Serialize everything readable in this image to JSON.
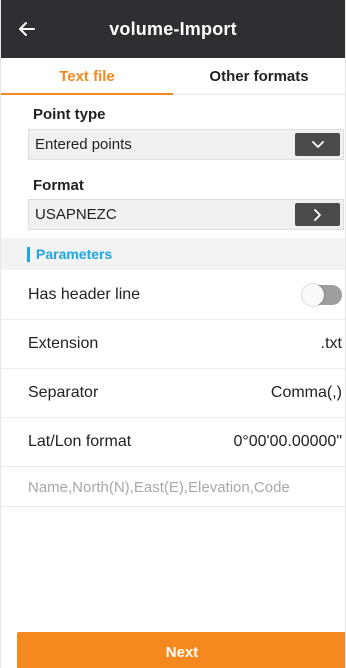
{
  "header": {
    "title": "volume-Import",
    "back_icon": "arrow-left-icon"
  },
  "tabs": [
    {
      "label": "Text file",
      "active": true
    },
    {
      "label": "Other formats",
      "active": false
    }
  ],
  "point_type": {
    "label": "Point type",
    "value": "Entered points",
    "icon": "chevron-down-icon"
  },
  "format": {
    "label": "Format",
    "value": "USAPNEZC",
    "icon": "chevron-right-icon"
  },
  "parameters": {
    "title": "Parameters",
    "has_header_line": {
      "label": "Has header line",
      "enabled": false
    },
    "extension": {
      "label": "Extension",
      "value": ".txt"
    },
    "separator": {
      "label": "Separator",
      "value": "Comma(,)"
    },
    "latlon_format": {
      "label": "Lat/Lon format",
      "value": "0°00'00.00000\""
    },
    "fields": {
      "value": "",
      "placeholder": "Name,North(N),East(E),Elevation,Code"
    }
  },
  "footer": {
    "next_label": "Next"
  },
  "colors": {
    "accent": "#f4891f",
    "header_bg": "#2f2f33",
    "section_accent": "#1ea6e2",
    "toggle_off": "#9e9e9e"
  }
}
